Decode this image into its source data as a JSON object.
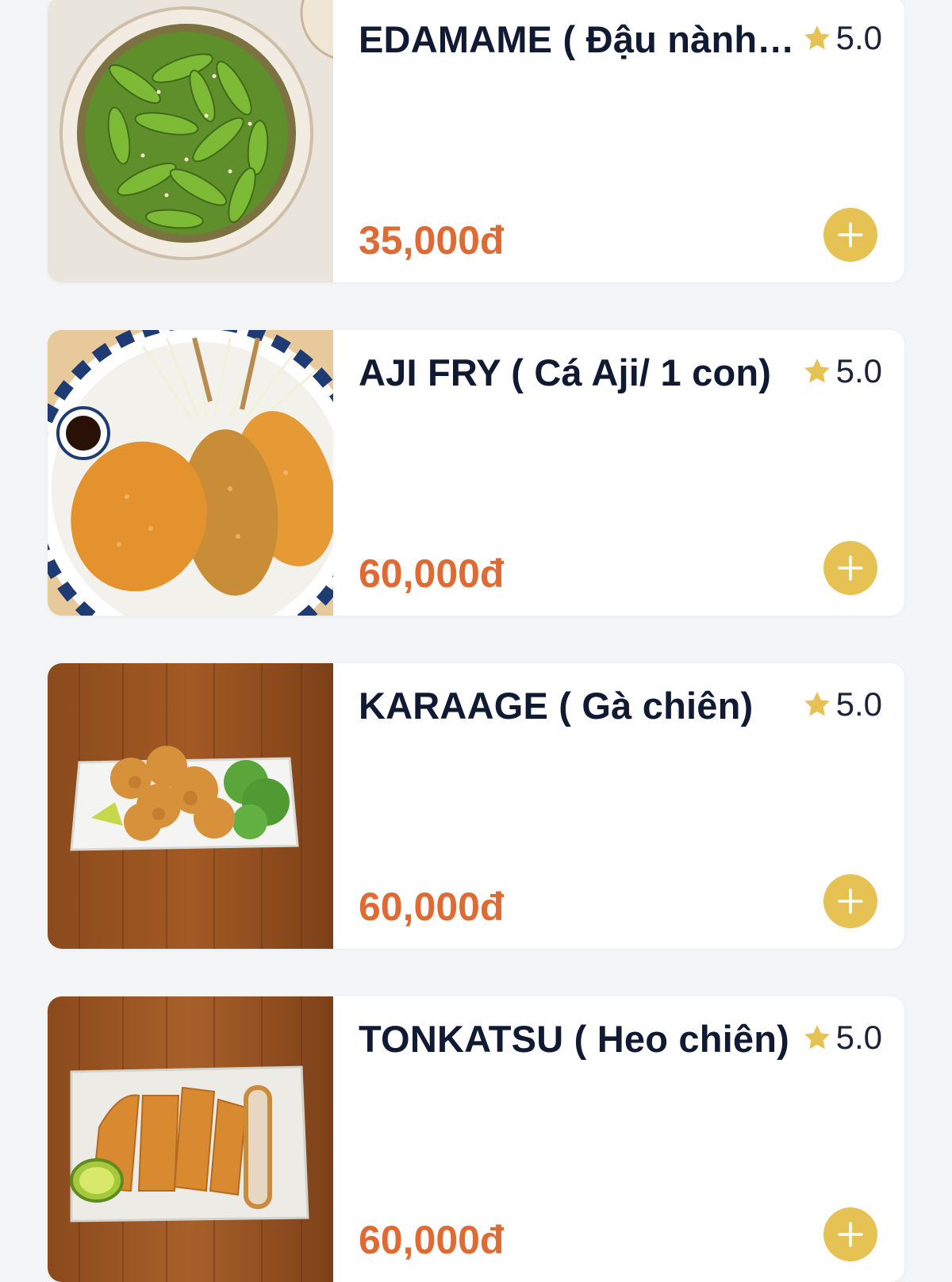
{
  "currency_symbol": "đ",
  "colors": {
    "accent": "#e6c254",
    "price": "#e06a33",
    "title": "#111a33",
    "background": "#f4f5f7"
  },
  "items": [
    {
      "name": "EDAMAME ( Đậu nành…",
      "rating": "5.0",
      "price": "35,000đ",
      "image": "edamame-photo",
      "icon": "star-icon"
    },
    {
      "name": "AJI FRY ( Cá Aji/ 1 con)",
      "rating": "5.0",
      "price": "60,000đ",
      "image": "aji-fry-photo",
      "icon": "star-icon"
    },
    {
      "name": "KARAAGE ( Gà chiên)",
      "rating": "5.0",
      "price": "60,000đ",
      "image": "karaage-photo",
      "icon": "star-icon"
    },
    {
      "name": "TONKATSU ( Heo chiên)",
      "rating": "5.0",
      "price": "60,000đ",
      "image": "tonkatsu-photo",
      "icon": "star-icon"
    }
  ]
}
